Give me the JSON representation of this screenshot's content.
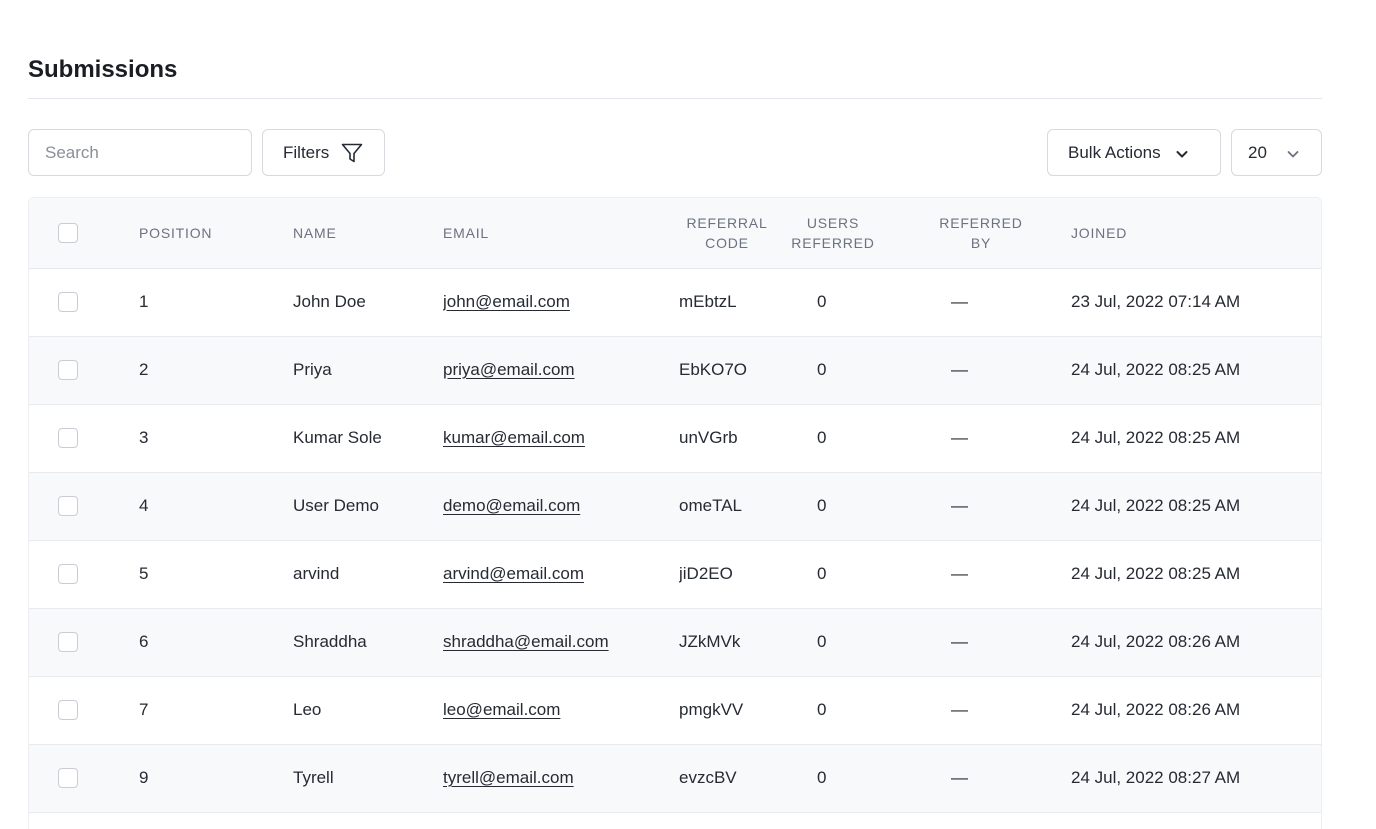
{
  "page": {
    "title": "Submissions"
  },
  "toolbar": {
    "search_placeholder": "Search",
    "filters_label": "Filters",
    "bulk_actions_label": "Bulk Actions",
    "per_page_value": "20"
  },
  "table": {
    "columns": {
      "position": "POSITION",
      "name": "NAME",
      "email": "EMAIL",
      "referral_code_1": "REFERRAL",
      "referral_code_2": "CODE",
      "users_referred_1": "USERS",
      "users_referred_2": "REFERRED",
      "referred_by_1": "REFERRED",
      "referred_by_2": "BY",
      "joined": "JOINED"
    },
    "rows": [
      {
        "position": "1",
        "name": "John Doe",
        "email": "john@email.com",
        "referral_code": "mEbtzL",
        "users_referred": "0",
        "referred_by": "—",
        "joined": "23 Jul, 2022 07:14 AM"
      },
      {
        "position": "2",
        "name": "Priya",
        "email": "priya@email.com",
        "referral_code": "EbKO7O",
        "users_referred": "0",
        "referred_by": "—",
        "joined": "24 Jul, 2022 08:25 AM"
      },
      {
        "position": "3",
        "name": "Kumar Sole",
        "email": "kumar@email.com",
        "referral_code": "unVGrb",
        "users_referred": "0",
        "referred_by": "—",
        "joined": "24 Jul, 2022 08:25 AM"
      },
      {
        "position": "4",
        "name": "User Demo",
        "email": "demo@email.com",
        "referral_code": "omeTAL",
        "users_referred": "0",
        "referred_by": "—",
        "joined": "24 Jul, 2022 08:25 AM"
      },
      {
        "position": "5",
        "name": "arvind",
        "email": "arvind@email.com",
        "referral_code": "jiD2EO",
        "users_referred": "0",
        "referred_by": "—",
        "joined": "24 Jul, 2022 08:25 AM"
      },
      {
        "position": "6",
        "name": "Shraddha",
        "email": "shraddha@email.com",
        "referral_code": "JZkMVk",
        "users_referred": "0",
        "referred_by": "—",
        "joined": "24 Jul, 2022 08:26 AM"
      },
      {
        "position": "7",
        "name": "Leo",
        "email": "leo@email.com",
        "referral_code": "pmgkVV",
        "users_referred": "0",
        "referred_by": "—",
        "joined": "24 Jul, 2022 08:26 AM"
      },
      {
        "position": "9",
        "name": "Tyrell",
        "email": "tyrell@email.com",
        "referral_code": "evzcBV",
        "users_referred": "0",
        "referred_by": "—",
        "joined": "24 Jul, 2022 08:27 AM"
      }
    ]
  }
}
